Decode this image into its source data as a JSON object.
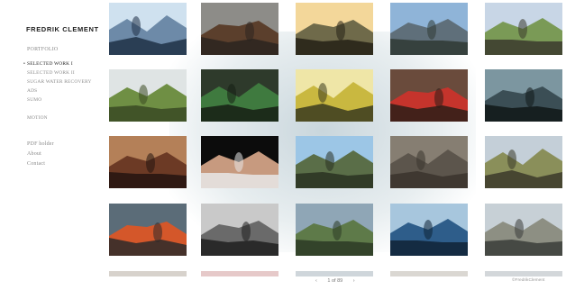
{
  "site": {
    "title": "FREDRIK CLEMENT"
  },
  "nav": {
    "portfolio": "PORTFOLIO",
    "items": [
      {
        "label": "SELECTED WORK I",
        "active": true
      },
      {
        "label": "SELECTED WORK II",
        "active": false
      },
      {
        "label": "SUGAR WATER RECOVERY",
        "active": false
      },
      {
        "label": "ADS",
        "active": false
      },
      {
        "label": "SUMO",
        "active": false
      }
    ],
    "motion": "MOTION",
    "pdf_holder": "PDF holder",
    "about": "About",
    "contact": "Contact"
  },
  "pager": {
    "prev": "‹",
    "status": "1 of 89",
    "next": "›"
  },
  "credit": "©FredrikClement",
  "colors": {
    "background": "#ffffff",
    "title_text": "#222222",
    "nav_text": "#8c8c8c"
  },
  "thumbnails": [
    {
      "subject": "hiker-on-misty-ridge",
      "colors": [
        "#cfe1ef",
        "#6d8aa8",
        "#1f3045"
      ]
    },
    {
      "subject": "striped-mountain-valley",
      "colors": [
        "#8d8c88",
        "#5b3f2c",
        "#2b2520"
      ]
    },
    {
      "subject": "runner-at-sunset",
      "colors": [
        "#f3d79a",
        "#6f6a4a",
        "#242015"
      ]
    },
    {
      "subject": "hikers-blue-sky-peaks",
      "colors": [
        "#8fb4d8",
        "#5f6f7a",
        "#2f3a34"
      ]
    },
    {
      "subject": "climber-grassy-slope",
      "colors": [
        "#c8d6e6",
        "#7a9a56",
        "#3b3a2d"
      ]
    },
    {
      "subject": "green-hills-mist",
      "colors": [
        "#dfe4e4",
        "#6f8f44",
        "#3a4a23"
      ]
    },
    {
      "subject": "hands-green-jacket",
      "colors": [
        "#2e3a2b",
        "#3f7a3f",
        "#161f14"
      ]
    },
    {
      "subject": "cyclist-yellow-light",
      "colors": [
        "#efe6a7",
        "#c9b840",
        "#3a3a1e"
      ]
    },
    {
      "subject": "couple-red-jackets",
      "colors": [
        "#6a4b3c",
        "#c5342c",
        "#2b1e18"
      ]
    },
    {
      "subject": "swimmer-in-water",
      "colors": [
        "#7c96a0",
        "#3b4e55",
        "#101718"
      ]
    },
    {
      "subject": "climber-red-rock",
      "colors": [
        "#b48058",
        "#6c3a25",
        "#241410"
      ]
    },
    {
      "subject": "woman-portrait-dark",
      "colors": [
        "#0c0c0c",
        "#c79a7f",
        "#e8e8e8"
      ]
    },
    {
      "subject": "trail-runner-mountains",
      "colors": [
        "#9cc6e6",
        "#5a6e48",
        "#2a3222"
      ]
    },
    {
      "subject": "rocky-scree-slope",
      "colors": [
        "#867e72",
        "#5c554c",
        "#3a342d"
      ]
    },
    {
      "subject": "hikers-on-ridge",
      "colors": [
        "#c4cfd8",
        "#8a8f5a",
        "#3b3a2a"
      ]
    },
    {
      "subject": "orange-jacket-rain",
      "colors": [
        "#5b6c78",
        "#d4572a",
        "#2b2a2a"
      ]
    },
    {
      "subject": "bw-shirtless-athlete",
      "colors": [
        "#c9c9c9",
        "#6a6a6a",
        "#1e1e1e"
      ]
    },
    {
      "subject": "valley-river-clouds",
      "colors": [
        "#8fa6b6",
        "#5e7a49",
        "#2c3a24"
      ]
    },
    {
      "subject": "jumping-into-lake",
      "colors": [
        "#a7c6dd",
        "#2e5d8a",
        "#0f2235"
      ]
    },
    {
      "subject": "runner-road-poles",
      "colors": [
        "#c7d0d6",
        "#8d8f83",
        "#3a3d3a"
      ]
    }
  ]
}
